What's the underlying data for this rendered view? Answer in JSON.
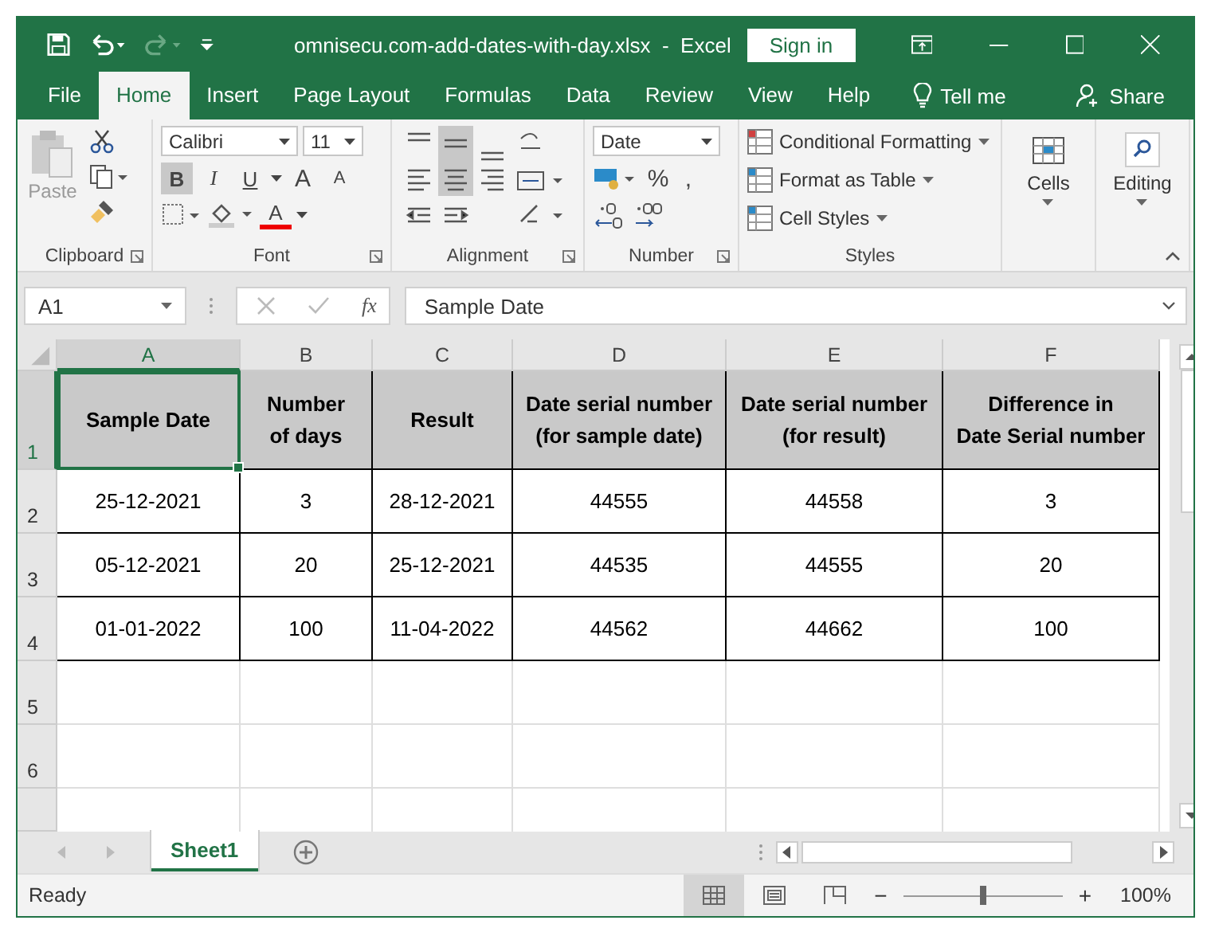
{
  "title_bar": {
    "title": "omnisecu.com-add-dates-with-day.xlsx  -  Excel",
    "sign_in": "Sign in"
  },
  "tabs": [
    {
      "label": "File",
      "selected": false
    },
    {
      "label": "Home",
      "selected": true
    },
    {
      "label": "Insert",
      "selected": false
    },
    {
      "label": "Page Layout",
      "selected": false
    },
    {
      "label": "Formulas",
      "selected": false
    },
    {
      "label": "Data",
      "selected": false
    },
    {
      "label": "Review",
      "selected": false
    },
    {
      "label": "View",
      "selected": false
    },
    {
      "label": "Help",
      "selected": false
    }
  ],
  "tell_me": "Tell me",
  "share": "Share",
  "ribbon": {
    "clipboard": {
      "label": "Clipboard",
      "paste": "Paste"
    },
    "font": {
      "label": "Font",
      "font_name": "Calibri",
      "font_size": "11",
      "bold": "B",
      "italic": "I",
      "underline": "U",
      "grow": "A",
      "shrink": "A",
      "font_color": "A"
    },
    "alignment": {
      "label": "Alignment"
    },
    "number": {
      "label": "Number",
      "format": "Date",
      "percent": "%",
      "comma": ","
    },
    "styles": {
      "label": "Styles",
      "items": [
        "Conditional Formatting",
        "Format as Table",
        "Cell Styles"
      ]
    },
    "cells": {
      "label": "Cells"
    },
    "editing": {
      "label": "Editing"
    }
  },
  "formula_bar": {
    "name_box": "A1",
    "fx": "fx",
    "value": "Sample Date"
  },
  "sheet": {
    "columns": [
      {
        "label": "A",
        "selected": true
      },
      {
        "label": "B",
        "selected": false
      },
      {
        "label": "C",
        "selected": false
      },
      {
        "label": "D",
        "selected": false
      },
      {
        "label": "E",
        "selected": false
      },
      {
        "label": "F",
        "selected": false
      }
    ],
    "rows": [
      {
        "number": "1",
        "kind": "header",
        "selected": true,
        "cells": [
          {
            "text": "Sample Date",
            "selected": true
          },
          {
            "text": "Number\nof days",
            "selected": false
          },
          {
            "text": "Result",
            "selected": false
          },
          {
            "text": "Date serial number\n(for sample date)",
            "selected": false
          },
          {
            "text": "Date serial number\n(for result)",
            "selected": false
          },
          {
            "text": "Difference in\nDate Serial number",
            "selected": false
          }
        ]
      },
      {
        "number": "2",
        "kind": "data",
        "selected": false,
        "cells": [
          {
            "text": "25-12-2021",
            "selected": false
          },
          {
            "text": "3",
            "selected": false
          },
          {
            "text": "28-12-2021",
            "selected": false
          },
          {
            "text": "44555",
            "selected": false
          },
          {
            "text": "44558",
            "selected": false
          },
          {
            "text": "3",
            "selected": false
          }
        ]
      },
      {
        "number": "3",
        "kind": "data",
        "selected": false,
        "cells": [
          {
            "text": "05-12-2021",
            "selected": false
          },
          {
            "text": "20",
            "selected": false
          },
          {
            "text": "25-12-2021",
            "selected": false
          },
          {
            "text": "44535",
            "selected": false
          },
          {
            "text": "44555",
            "selected": false
          },
          {
            "text": "20",
            "selected": false
          }
        ]
      },
      {
        "number": "4",
        "kind": "data",
        "selected": false,
        "cells": [
          {
            "text": "01-01-2022",
            "selected": false
          },
          {
            "text": "100",
            "selected": false
          },
          {
            "text": "11-04-2022",
            "selected": false
          },
          {
            "text": "44562",
            "selected": false
          },
          {
            "text": "44662",
            "selected": false
          },
          {
            "text": "100",
            "selected": false
          }
        ]
      },
      {
        "number": "5",
        "kind": "empty",
        "selected": false
      },
      {
        "number": "6",
        "kind": "empty",
        "selected": false
      }
    ]
  },
  "sheet_tabs": [
    {
      "label": "Sheet1",
      "selected": true
    }
  ],
  "status_bar": {
    "status": "Ready",
    "views": [
      {
        "kind": "normal",
        "selected": true
      },
      {
        "kind": "page_layout",
        "selected": false
      },
      {
        "kind": "page_break",
        "selected": false
      }
    ],
    "zoom_out": "−",
    "level": 0.5,
    "zoom_in": "+",
    "zoom": "100%"
  }
}
